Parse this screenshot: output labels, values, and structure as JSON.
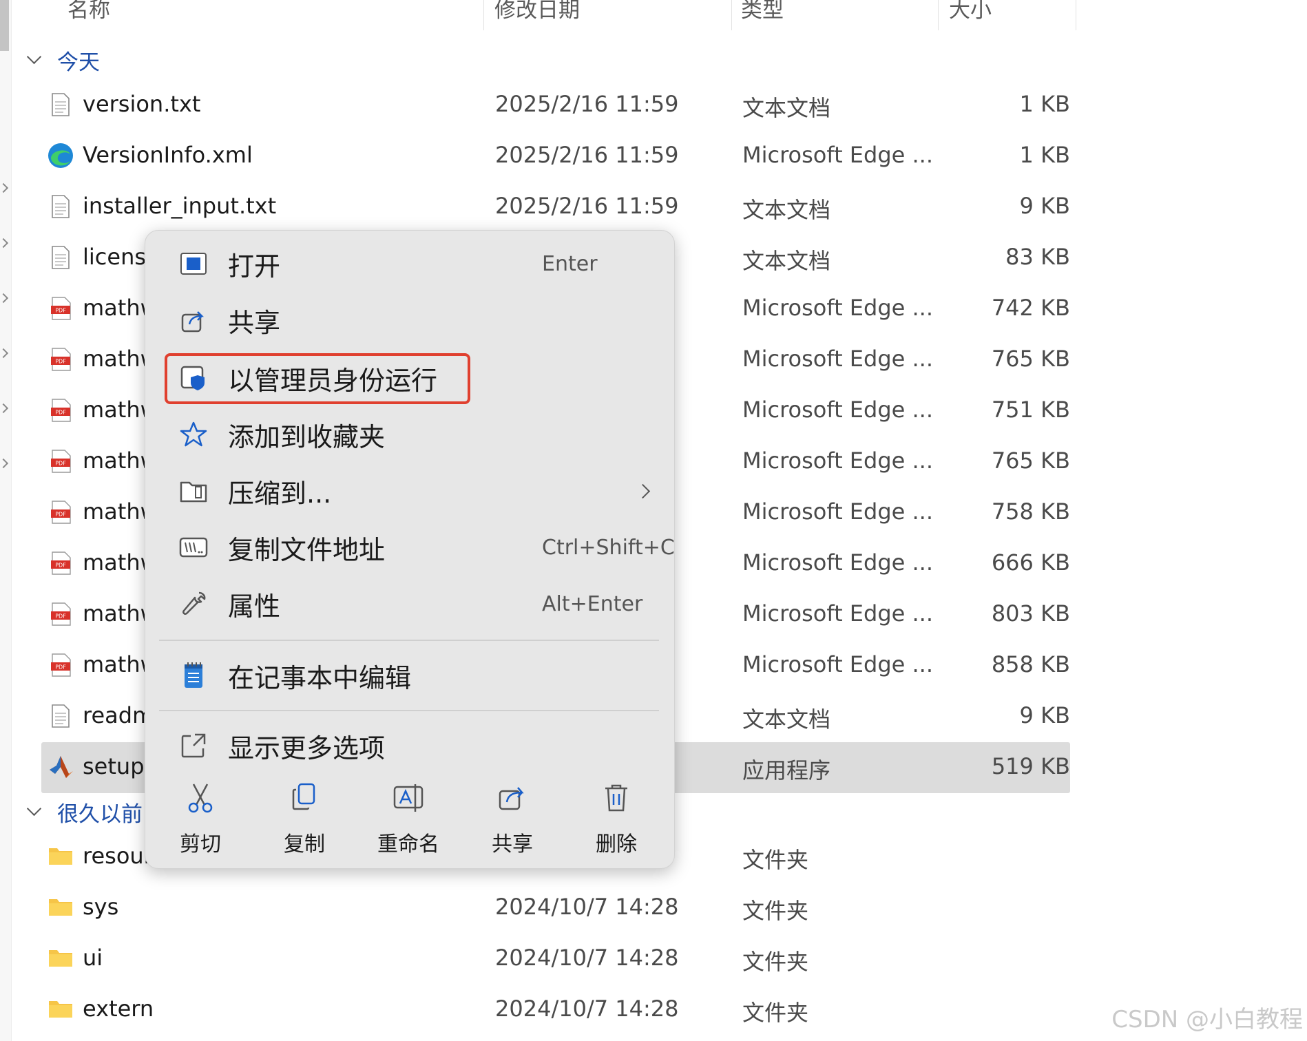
{
  "columns": {
    "name": "名称",
    "date": "修改日期",
    "type": "类型",
    "size": "大小"
  },
  "groups": {
    "today": "今天",
    "long_ago": "很久以前"
  },
  "files_today": [
    {
      "name": "version.txt",
      "date": "2025/2/16 11:59",
      "type": "文本文档",
      "size": "1 KB",
      "icon": "text-file-icon"
    },
    {
      "name": "VersionInfo.xml",
      "date": "2025/2/16 11:59",
      "type": "Microsoft Edge ...",
      "size": "1 KB",
      "icon": "edge-icon"
    },
    {
      "name": "installer_input.txt",
      "date": "2025/2/16 11:59",
      "type": "文本文档",
      "size": "9 KB",
      "icon": "text-file-icon"
    },
    {
      "name": "license",
      "date": "",
      "type": "文本文档",
      "size": "83 KB",
      "icon": "text-file-icon"
    },
    {
      "name": "mathw",
      "date": "",
      "type": "Microsoft Edge ...",
      "size": "742 KB",
      "icon": "pdf-icon"
    },
    {
      "name": "mathw",
      "date": "",
      "type": "Microsoft Edge ...",
      "size": "765 KB",
      "icon": "pdf-icon"
    },
    {
      "name": "mathw",
      "date": "",
      "type": "Microsoft Edge ...",
      "size": "751 KB",
      "icon": "pdf-icon"
    },
    {
      "name": "mathw",
      "date": "",
      "type": "Microsoft Edge ...",
      "size": "765 KB",
      "icon": "pdf-icon"
    },
    {
      "name": "mathw",
      "date": "",
      "type": "Microsoft Edge ...",
      "size": "758 KB",
      "icon": "pdf-icon"
    },
    {
      "name": "mathw",
      "date": "",
      "type": "Microsoft Edge ...",
      "size": "666 KB",
      "icon": "pdf-icon"
    },
    {
      "name": "mathw",
      "date": "",
      "type": "Microsoft Edge ...",
      "size": "803 KB",
      "icon": "pdf-icon"
    },
    {
      "name": "mathw",
      "date": "",
      "type": "Microsoft Edge ...",
      "size": "858 KB",
      "icon": "pdf-icon"
    },
    {
      "name": "readm",
      "date": "",
      "type": "文本文档",
      "size": "9 KB",
      "icon": "text-file-icon"
    },
    {
      "name": "setup.",
      "date": "",
      "type": "应用程序",
      "size": "519 KB",
      "icon": "matlab-icon",
      "selected": true
    }
  ],
  "files_long_ago": [
    {
      "name": "resour",
      "date": "",
      "type": "文件夹",
      "size": "",
      "icon": "folder-icon"
    },
    {
      "name": "sys",
      "date": "2024/10/7 14:28",
      "type": "文件夹",
      "size": "",
      "icon": "folder-icon"
    },
    {
      "name": "ui",
      "date": "2024/10/7 14:28",
      "type": "文件夹",
      "size": "",
      "icon": "folder-icon"
    },
    {
      "name": "extern",
      "date": "2024/10/7 14:28",
      "type": "文件夹",
      "size": "",
      "icon": "folder-icon"
    }
  ],
  "context_menu": {
    "items": [
      {
        "label": "打开",
        "shortcut": "Enter",
        "icon": "open-app-icon"
      },
      {
        "label": "共享",
        "shortcut": "",
        "icon": "share-icon"
      },
      {
        "label": "以管理员身份运行",
        "shortcut": "",
        "icon": "run-as-admin-shield-icon"
      },
      {
        "label": "添加到收藏夹",
        "shortcut": "",
        "icon": "star-icon"
      },
      {
        "label": "压缩到...",
        "shortcut": "",
        "icon": "zip-folder-icon"
      },
      {
        "label": "复制文件地址",
        "shortcut": "Ctrl+Shift+C",
        "icon": "copy-path-icon"
      },
      {
        "label": "属性",
        "shortcut": "Alt+Enter",
        "icon": "wrench-icon"
      }
    ],
    "notepad": {
      "label": "在记事本中编辑",
      "icon": "notepad-icon"
    },
    "more": {
      "label": "显示更多选项",
      "icon": "more-options-icon"
    },
    "actions": [
      {
        "label": "剪切",
        "icon": "cut-icon"
      },
      {
        "label": "复制",
        "icon": "copy-icon"
      },
      {
        "label": "重命名",
        "icon": "rename-icon"
      },
      {
        "label": "共享",
        "icon": "share-icon"
      },
      {
        "label": "删除",
        "icon": "trash-icon"
      }
    ]
  },
  "watermark": "CSDN @小白教程",
  "colors": {
    "highlight": "#e0402f",
    "selection": "#dcdcdc",
    "group_link": "#1f4fa8"
  }
}
